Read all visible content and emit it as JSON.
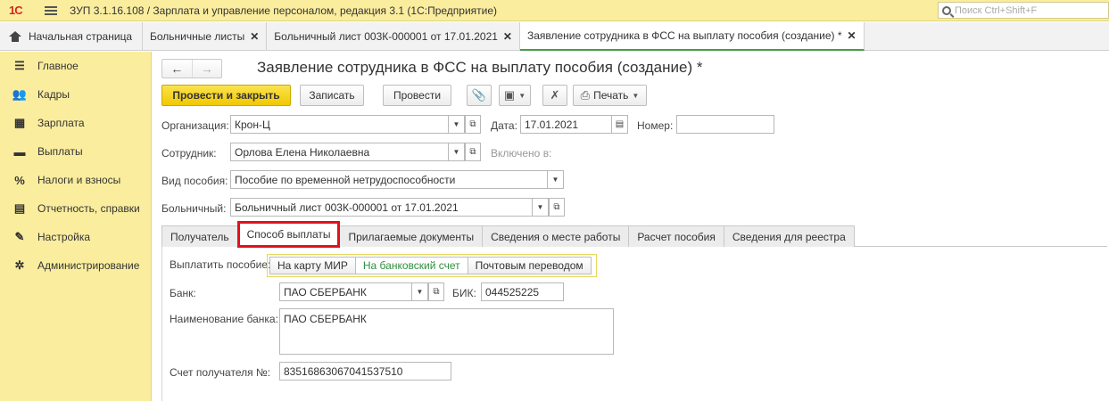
{
  "app": {
    "logo": "1С",
    "title": "ЗУП 3.1.16.108 / Зарплата и управление персоналом, редакция 3.1  (1С:Предприятие)",
    "search_placeholder": "Поиск Ctrl+Shift+F"
  },
  "window_tabs": [
    {
      "label": "Начальная страница"
    },
    {
      "label": "Больничные листы"
    },
    {
      "label": "Больничный лист 003К-000001 от 17.01.2021"
    },
    {
      "label": "Заявление сотрудника в ФСС на выплату пособия (создание) *"
    }
  ],
  "sidebar": {
    "items": [
      {
        "label": "Главное",
        "icon": "menu-icon"
      },
      {
        "label": "Кадры",
        "icon": "people-icon"
      },
      {
        "label": "Зарплата",
        "icon": "calculator-icon"
      },
      {
        "label": "Выплаты",
        "icon": "wallet-icon"
      },
      {
        "label": "Налоги и взносы",
        "icon": "percent-icon"
      },
      {
        "label": "Отчетность, справки",
        "icon": "report-icon"
      },
      {
        "label": "Настройка",
        "icon": "wrench-icon"
      },
      {
        "label": "Администрирование",
        "icon": "gear-icon"
      }
    ]
  },
  "document": {
    "title": "Заявление сотрудника в ФСС на выплату пособия (создание) *"
  },
  "toolbar": {
    "post_close": "Провести и закрыть",
    "save": "Записать",
    "post": "Провести",
    "print": "Печать"
  },
  "form": {
    "org_label": "Организация:",
    "org_value": "Крон-Ц",
    "date_label": "Дата:",
    "date_value": "17.01.2021",
    "number_label": "Номер:",
    "number_value": "",
    "employee_label": "Сотрудник:",
    "employee_value": "Орлова Елена Николаевна",
    "included_label": "Включено в:",
    "benefit_label": "Вид пособия:",
    "benefit_value": "Пособие по временной нетрудоспособности",
    "sick_label": "Больничный:",
    "sick_value": "Больничный лист 003К-000001 от 17.01.2021"
  },
  "form_tabs": [
    {
      "label": "Получатель"
    },
    {
      "label": "Способ выплаты"
    },
    {
      "label": "Прилагаемые документы"
    },
    {
      "label": "Сведения о месте работы"
    },
    {
      "label": "Расчет пособия"
    },
    {
      "label": "Сведения для реестра"
    }
  ],
  "payment": {
    "method_label": "Выплатить пособие:",
    "options": [
      "На карту МИР",
      "На банковский счет",
      "Почтовым переводом"
    ],
    "selected": "На банковский счет",
    "bank_label": "Банк:",
    "bank_value": "ПАО СБЕРБАНК",
    "bik_label": "БИК:",
    "bik_value": "044525225",
    "bank_name_label": "Наименование банка:",
    "bank_name_value": "ПАО СБЕРБАНК",
    "account_label": "Счет получателя №:",
    "account_value": "83516863067041537510"
  },
  "colors": {
    "titlebar_bg": "#fbed9e",
    "primary_button": "#f1c800",
    "active_tab_highlight": "#e0121b",
    "selected_option_text": "#2f8f3e"
  }
}
